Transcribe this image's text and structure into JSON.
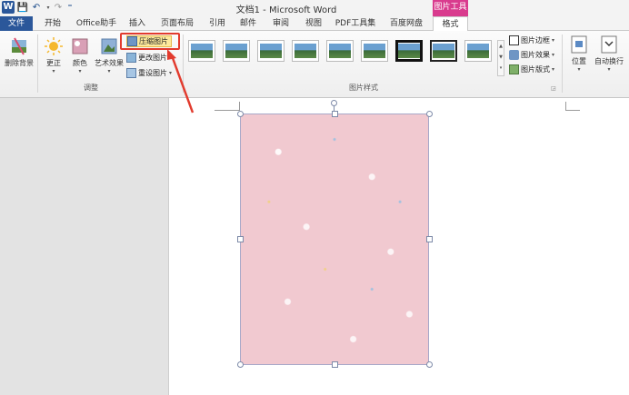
{
  "window": {
    "title": "文档1 - Microsoft Word",
    "app_icon_letter": "W"
  },
  "qat": {
    "save": "💾",
    "undo": "↶",
    "redo": "↷",
    "customize": "⁼"
  },
  "tabs": [
    {
      "label": "文件",
      "name": "tab-file"
    },
    {
      "label": "开始",
      "name": "tab-home"
    },
    {
      "label": "Office助手",
      "name": "tab-office-assistant"
    },
    {
      "label": "插入",
      "name": "tab-insert"
    },
    {
      "label": "页面布局",
      "name": "tab-page-layout"
    },
    {
      "label": "引用",
      "name": "tab-references"
    },
    {
      "label": "邮件",
      "name": "tab-mailings"
    },
    {
      "label": "审阅",
      "name": "tab-review"
    },
    {
      "label": "视图",
      "name": "tab-view"
    },
    {
      "label": "PDF工具集",
      "name": "tab-pdf-tools"
    },
    {
      "label": "百度网盘",
      "name": "tab-baidu-netdisk"
    },
    {
      "label": "格式",
      "name": "tab-format"
    }
  ],
  "context_tab_header": "图片工具",
  "ribbon": {
    "remove_background": "删除背景",
    "corrections": "更正",
    "color": "颜色",
    "artistic_effects": "艺术效果",
    "compress_pictures": "压缩图片",
    "change_picture": "更改图片",
    "reset_picture": "重设图片",
    "adjust_group": "调整",
    "picture_styles_group": "图片样式",
    "picture_border": "图片边框",
    "picture_effects": "图片效果",
    "picture_layout": "图片版式",
    "position": "位置",
    "wrap_text": "自动换行"
  },
  "colors": {
    "file_tab": "#2b579a",
    "context_tab": "#d93b8e",
    "highlight": "#e23b2e",
    "picture_bg": "#f1c9d0"
  }
}
